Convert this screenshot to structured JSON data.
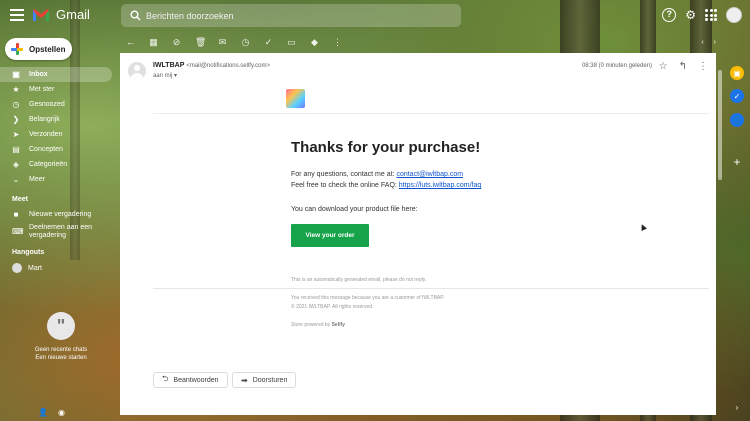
{
  "app": {
    "title": "Gmail",
    "search_placeholder": "Berichten doorzoeken"
  },
  "compose": {
    "label": "Opstellen"
  },
  "nav": {
    "items": [
      {
        "label": "Inbox",
        "icon": "inbox-icon",
        "count": "",
        "active": true
      },
      {
        "label": "Met ster",
        "icon": "star-icon",
        "count": ""
      },
      {
        "label": "Gesnoozed",
        "icon": "clock-icon",
        "count": ""
      },
      {
        "label": "Belangrijk",
        "icon": "label-important-icon",
        "count": ""
      },
      {
        "label": "Verzonden",
        "icon": "send-icon",
        "count": ""
      },
      {
        "label": "Concepten",
        "icon": "draft-icon",
        "count": ""
      },
      {
        "label": "Categorieën",
        "icon": "category-icon",
        "count": ""
      },
      {
        "label": "Meer",
        "icon": "chevron-down-icon",
        "count": ""
      }
    ]
  },
  "meet": {
    "title": "Meet",
    "new_meeting": "Nieuwe vergadering",
    "join_meeting": "Deelnemen aan een vergadering"
  },
  "hangouts": {
    "title": "Hangouts",
    "user": "Mart",
    "empty_line1": "Geen recente chats",
    "empty_line2": "Een nieuwe starten"
  },
  "email": {
    "sender_name": "IWLTBAP",
    "sender_email": "<mail@notifications.sellfy.com>",
    "to": "aan mij",
    "date": "08:38 (0 minuten geleden)",
    "title": "Thanks for your purchase!",
    "contact_text": "For any questions, contact me at: ",
    "contact_link": "contact@iwltbap.com",
    "faq_text": "Feel free to check the online FAQ: ",
    "faq_link": "https://luts.iwltbap.com/faq",
    "download_text": "You can download your product file here:",
    "button_label": "View your order",
    "auto_note": "This is an automatically generated email, please do not reply.",
    "received_note": "You received this message because you are a customer of IWLTBAP.",
    "copyright": "© 2021 IWLTBAP. All rights reserved.",
    "powered_prefix": "Store powered by ",
    "powered_brand": "Sellfy"
  },
  "actions": {
    "reply_label": "Beantwoorden",
    "forward_label": "Doorsturen"
  }
}
